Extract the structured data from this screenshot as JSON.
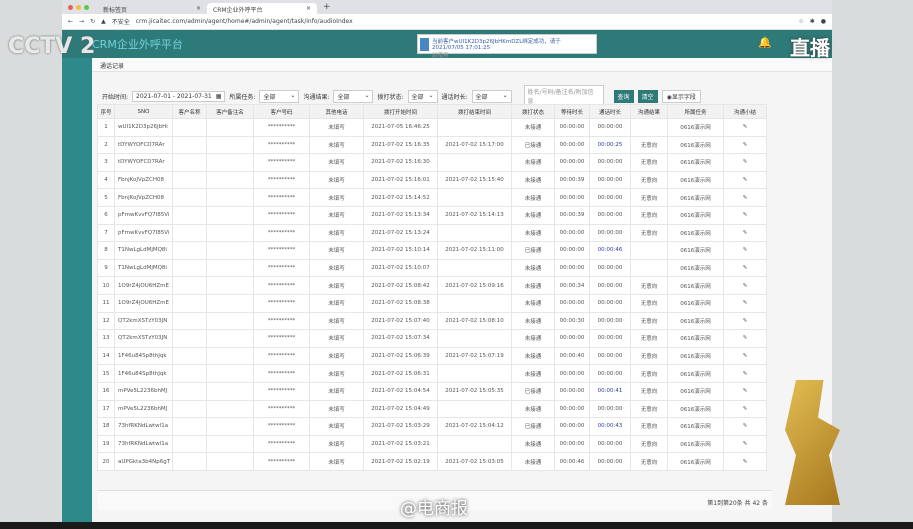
{
  "browser": {
    "tabs": [
      "新标签页",
      "CRM企业外呼平台"
    ],
    "security": "不安全",
    "url": "crm.jicaitec.com/admin/agent/home#/admin/agent/task/info/audioIndex"
  },
  "app": {
    "title": "CRM企业外呼平台",
    "notice": "当前客户wUI1K2D3p26JbHKmDZL绑定成功，请于2021/07/05 17:01:25",
    "notice_sub": "前使用"
  },
  "breadcrumb": "通话记录",
  "filters": {
    "start_label": "开始时间:",
    "date_range": "2021-07-01 - 2021-07-31",
    "task_label": "所属任务:",
    "task": "全部",
    "result_label": "沟通结果:",
    "result": "全部",
    "status_label": "拨打状态:",
    "status": "全部",
    "duration_label": "通话时长:",
    "duration": "全部",
    "search_placeholder": "姓名/号码/备注名/附加信息",
    "query": "查询",
    "clear": "清空",
    "show_fields": "显示字段"
  },
  "table": {
    "headers": [
      "序号",
      "SNO",
      "客户名称",
      "客户备注名",
      "客户号码",
      "其他电话",
      "拨打开始时间",
      "拨打结束时间",
      "拨打状态",
      "等待时长",
      "通话时长",
      "沟通结果",
      "所属任务",
      "沟通小结"
    ],
    "rows": [
      [
        "1",
        "wUI1K2D3p26JbHi",
        "",
        "",
        "**********",
        "未填写",
        "2021-07-05 16:46:25",
        "",
        "未接通",
        "00:00:00",
        "00:00:00",
        "",
        "0616演示网"
      ],
      [
        "2",
        "tDYWYOFCD7RAr",
        "",
        "",
        "**********",
        "未填写",
        "2021-07-02 15:16:35",
        "2021-07-02 15:17:00",
        "已接通",
        "00:00:00",
        "00:00:25",
        "无意向",
        "0616演示网"
      ],
      [
        "3",
        "tDYWYOFCD7RAr",
        "",
        "",
        "**********",
        "未填写",
        "2021-07-02 15:16:30",
        "",
        "未接通",
        "00:00:00",
        "00:00:00",
        "无意向",
        "0616演示网"
      ],
      [
        "4",
        "FbnjKoJVpZCH08",
        "",
        "",
        "**********",
        "未填写",
        "2021-07-02 15:16:01",
        "2021-07-02 15:15:40",
        "未接通",
        "00:00:39",
        "00:00:00",
        "无意向",
        "0616演示网"
      ],
      [
        "5",
        "FbnjKoJVpZCH08",
        "",
        "",
        "**********",
        "未填写",
        "2021-07-02 15:14:52",
        "",
        "未接通",
        "00:00:00",
        "00:00:00",
        "无意向",
        "0616演示网"
      ],
      [
        "6",
        "pFmwKvvFQ7I85Vi",
        "",
        "",
        "**********",
        "未填写",
        "2021-07-02 15:13:34",
        "2021-07-02 15:14:13",
        "未接通",
        "00:00:39",
        "00:00:00",
        "无意向",
        "0616演示网"
      ],
      [
        "7",
        "pFmwKvvFQ7I85Vi",
        "",
        "",
        "**********",
        "未填写",
        "2021-07-02 15:13:24",
        "",
        "未接通",
        "00:00:00",
        "00:00:00",
        "无意向",
        "0616演示网"
      ],
      [
        "8",
        "T1NwLgLdMjMQ8i",
        "",
        "",
        "**********",
        "未填写",
        "2021-07-02 15:10:14",
        "2021-07-02 15:11:00",
        "已接通",
        "00:00:00",
        "00:00:46",
        "",
        "0616演示网"
      ],
      [
        "9",
        "T1NwLgLdMjMQ8i",
        "",
        "",
        "**********",
        "未填写",
        "2021-07-02 15:10:07",
        "",
        "未接通",
        "00:00:00",
        "00:00:00",
        "",
        "0616演示网"
      ],
      [
        "10",
        "1O9rZ4jOU6HZmE",
        "",
        "",
        "**********",
        "未填写",
        "2021-07-02 15:08:42",
        "2021-07-02 15:09:16",
        "未接通",
        "00:00:34",
        "00:00:00",
        "无意向",
        "0616演示网"
      ],
      [
        "11",
        "1O9rZ4jOU6HZmE",
        "",
        "",
        "**********",
        "未填写",
        "2021-07-02 15:08:38",
        "",
        "未接通",
        "00:00:00",
        "00:00:00",
        "无意向",
        "0616演示网"
      ],
      [
        "12",
        "QT2kmXSTzY03JN",
        "",
        "",
        "**********",
        "未填写",
        "2021-07-02 15:07:40",
        "2021-07-02 15:08:10",
        "未接通",
        "00:00:30",
        "00:00:00",
        "无意向",
        "0616演示网"
      ],
      [
        "13",
        "QT2kmXSTzY03JN",
        "",
        "",
        "**********",
        "未填写",
        "2021-07-02 15:07:34",
        "",
        "未接通",
        "00:00:00",
        "00:00:00",
        "无意向",
        "0616演示网"
      ],
      [
        "14",
        "1F46u84Sp8thJqk",
        "",
        "",
        "**********",
        "未填写",
        "2021-07-02 15:06:39",
        "2021-07-02 15:07:19",
        "未接通",
        "00:00:40",
        "00:00:00",
        "无意向",
        "0616演示网"
      ],
      [
        "15",
        "1F46u84Sp8thJqk",
        "",
        "",
        "**********",
        "未填写",
        "2021-07-02 15:06:31",
        "",
        "未接通",
        "00:00:00",
        "00:00:00",
        "无意向",
        "0616演示网"
      ],
      [
        "16",
        "mPVe5L2236bhMJ",
        "",
        "",
        "**********",
        "未填写",
        "2021-07-02 15:04:54",
        "2021-07-02 15:05:35",
        "已接通",
        "00:00:00",
        "00:00:41",
        "无意向",
        "0616演示网"
      ],
      [
        "17",
        "mPVe5L2236bhMJ",
        "",
        "",
        "**********",
        "未填写",
        "2021-07-02 15:04:49",
        "",
        "未接通",
        "00:00:00",
        "00:00:00",
        "无意向",
        "0616演示网"
      ],
      [
        "18",
        "73hfRKNdLwtwl1a",
        "",
        "",
        "**********",
        "未填写",
        "2021-07-02 15:03:29",
        "2021-07-02 15:04:12",
        "已接通",
        "00:00:00",
        "00:00:43",
        "无意向",
        "0616演示网"
      ],
      [
        "19",
        "73hfRKNdLwtwl1a",
        "",
        "",
        "**********",
        "未填写",
        "2021-07-02 15:03:21",
        "",
        "未接通",
        "00:00:00",
        "00:00:00",
        "无意向",
        "0616演示网"
      ],
      [
        "20",
        "aUPGkta3b4Np6gT",
        "",
        "",
        "**********",
        "未填写",
        "2021-07-02 15:02:19",
        "2021-07-02 15:03:05",
        "未接通",
        "00:00:46",
        "00:00:00",
        "无意向",
        "0616演示网"
      ]
    ]
  },
  "pagination": "第1到第20条  共 42 条",
  "overlay": {
    "channel": "CCTV 2",
    "live": "直播",
    "weibo": "@电商报"
  },
  "colors": {
    "header": "#2e7a78",
    "sidebar": "#2e8a8a",
    "link": "#2c3fa0"
  }
}
